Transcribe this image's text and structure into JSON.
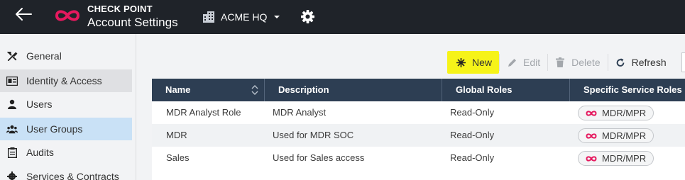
{
  "header": {
    "brand": "CHECK POINT",
    "title": "Account Settings",
    "environment": "ACME HQ",
    "icons": [
      "back-arrow-icon",
      "checkpoint-logo-icon",
      "building-icon",
      "caret-down-icon",
      "gear-icon"
    ],
    "brand_color": "#e5195e"
  },
  "sidebar": {
    "items": [
      {
        "label": "General",
        "icon": "tools-icon"
      },
      {
        "label": "Identity & Access",
        "icon": "id-card-icon"
      },
      {
        "label": "Users",
        "icon": "user-icon"
      },
      {
        "label": "User Groups",
        "icon": "users-icon"
      },
      {
        "label": "Audits",
        "icon": "clipboard-icon"
      },
      {
        "label": "Services & Contracts",
        "icon": "gear-icon"
      }
    ],
    "selected": "User Groups"
  },
  "toolbar": {
    "new_label": "New",
    "edit_label": "Edit",
    "delete_label": "Delete",
    "refresh_label": "Refresh"
  },
  "table": {
    "columns": [
      "Name",
      "Description",
      "Global Roles",
      "Specific Service Roles"
    ],
    "rows": [
      {
        "name": "MDR Analyst Role",
        "description": "MDR Analyst",
        "global_roles": "Read-Only",
        "service_role": "MDR/MPR"
      },
      {
        "name": "MDR",
        "description": "Used for MDR SOC",
        "global_roles": "Read-Only",
        "service_role": "MDR/MPR"
      },
      {
        "name": "Sales",
        "description": "Used for Sales access",
        "global_roles": "Read-Only",
        "service_role": "MDR/MPR"
      }
    ]
  }
}
